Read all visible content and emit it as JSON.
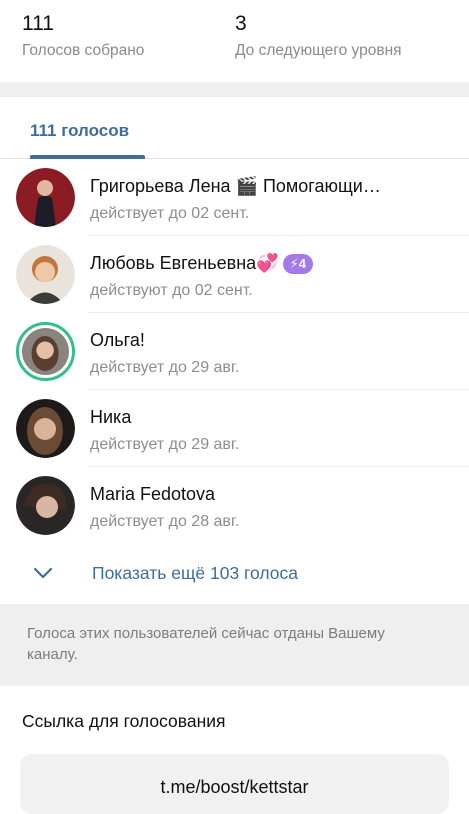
{
  "stats": [
    {
      "value": "111",
      "caption": "Голосов собрано"
    },
    {
      "value": "3",
      "caption": "До следующего уровня"
    }
  ],
  "tabs": [
    {
      "label": "111 голосов"
    }
  ],
  "users": [
    {
      "name": "Григорьева Лена 🎬 Помогающи…",
      "status": "действует до 02 сент.",
      "avatar_color": "#3a2a2e",
      "ring": false
    },
    {
      "name": "Любовь Евгеньевна💞",
      "badge": "⚡4",
      "status": "действуют до 02 сент.",
      "avatar_color": "#c9a58e",
      "ring": false
    },
    {
      "name": "Ольга!",
      "status": "действует до 29 авг.",
      "avatar_color": "#7c6458",
      "ring": true
    },
    {
      "name": "Ника",
      "status": "действует до 29 авг.",
      "avatar_color": "#3b2f2c",
      "ring": false
    },
    {
      "name": "Maria Fedotova",
      "status": "действует до 28 авг.",
      "avatar_color": "#2e2b2b",
      "ring": false
    }
  ],
  "show_more": {
    "label": "Показать ещё 103 голоса",
    "icon": "chevron-down-icon"
  },
  "note": {
    "text": "Голоса этих пользователей сейчас отданы Вашему каналу."
  },
  "link_section": {
    "title": "Ссылка для голосования",
    "link": "t.me/boost/kettstar"
  },
  "colors": {
    "accent": "#3f6d9b",
    "badge": "#a679e9",
    "ring": "#31c08a",
    "muted_text": "#8d8d8d",
    "section_bg": "#efefef"
  }
}
